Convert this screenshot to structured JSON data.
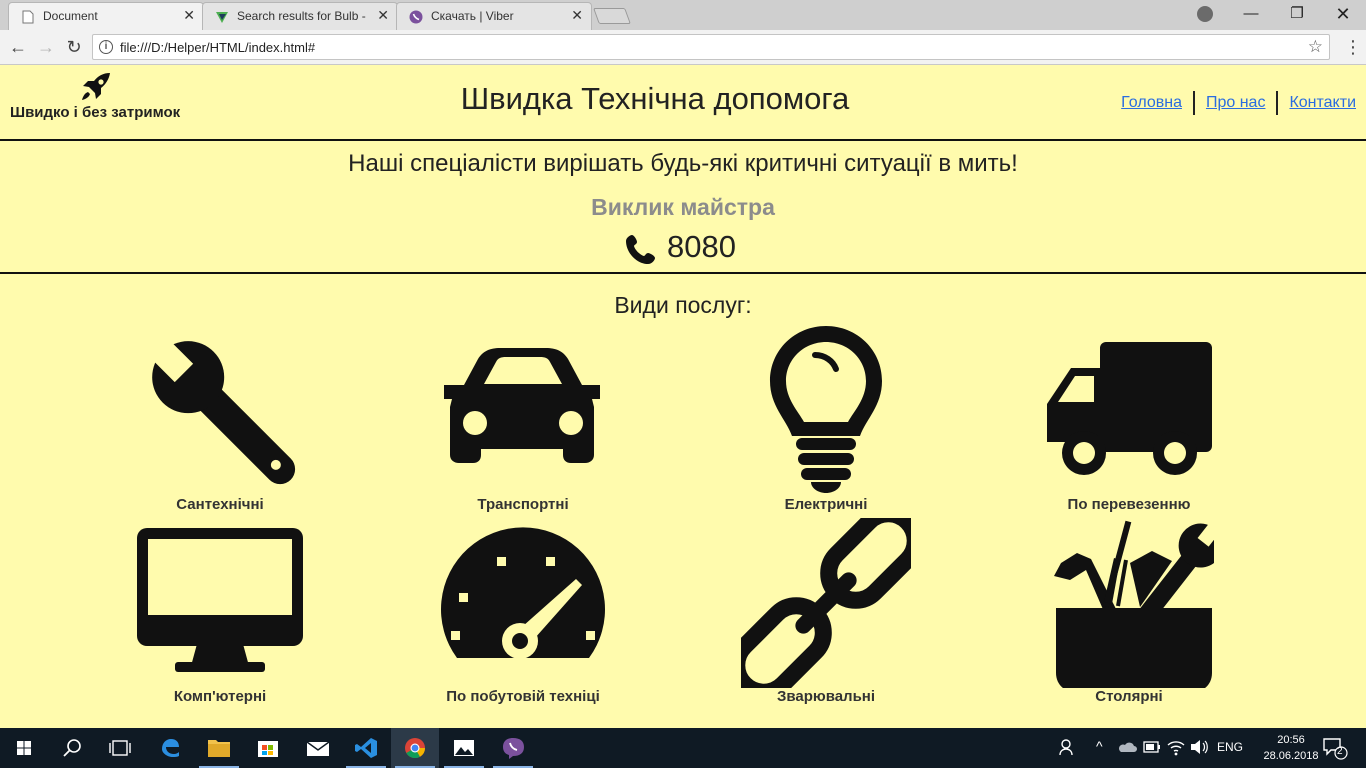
{
  "browser": {
    "tabs": [
      {
        "title": "Document",
        "active": true
      },
      {
        "title": "Search results for Bulb - F",
        "active": false
      },
      {
        "title": "Скачать | Viber",
        "active": false
      }
    ],
    "url": "file:///D:/Helper/HTML/index.html#"
  },
  "site": {
    "logo_text": "Швидко і без затримок",
    "title": "Швидка Технічна допомога",
    "nav": [
      "Головна",
      "Про нас",
      "Контакти"
    ],
    "tagline": "Наші спеціалісти вирішать будь-які критичні ситуації в мить!",
    "call_label": "Виклик майстра",
    "phone": "8080",
    "services_title": "Види послуг:",
    "services": [
      {
        "label": "Сантехнічні",
        "icon": "wrench-icon"
      },
      {
        "label": "Транспортні",
        "icon": "car-icon"
      },
      {
        "label": "Електричні",
        "icon": "bulb-icon"
      },
      {
        "label": "По перевезенню",
        "icon": "truck-icon"
      },
      {
        "label": "Комп'ютерні",
        "icon": "monitor-icon"
      },
      {
        "label": "По побутовій техніці",
        "icon": "gauge-icon"
      },
      {
        "label": "Зварювальні",
        "icon": "chain-icon"
      },
      {
        "label": "Столярні",
        "icon": "toolbox-icon"
      }
    ]
  },
  "taskbar": {
    "language": "ENG",
    "time": "20:56",
    "date": "28.06.2018",
    "notifications": "2"
  },
  "colors": {
    "page_background": "#fffbad",
    "link": "#2a6de0",
    "call_label": "#8c8c8c"
  }
}
